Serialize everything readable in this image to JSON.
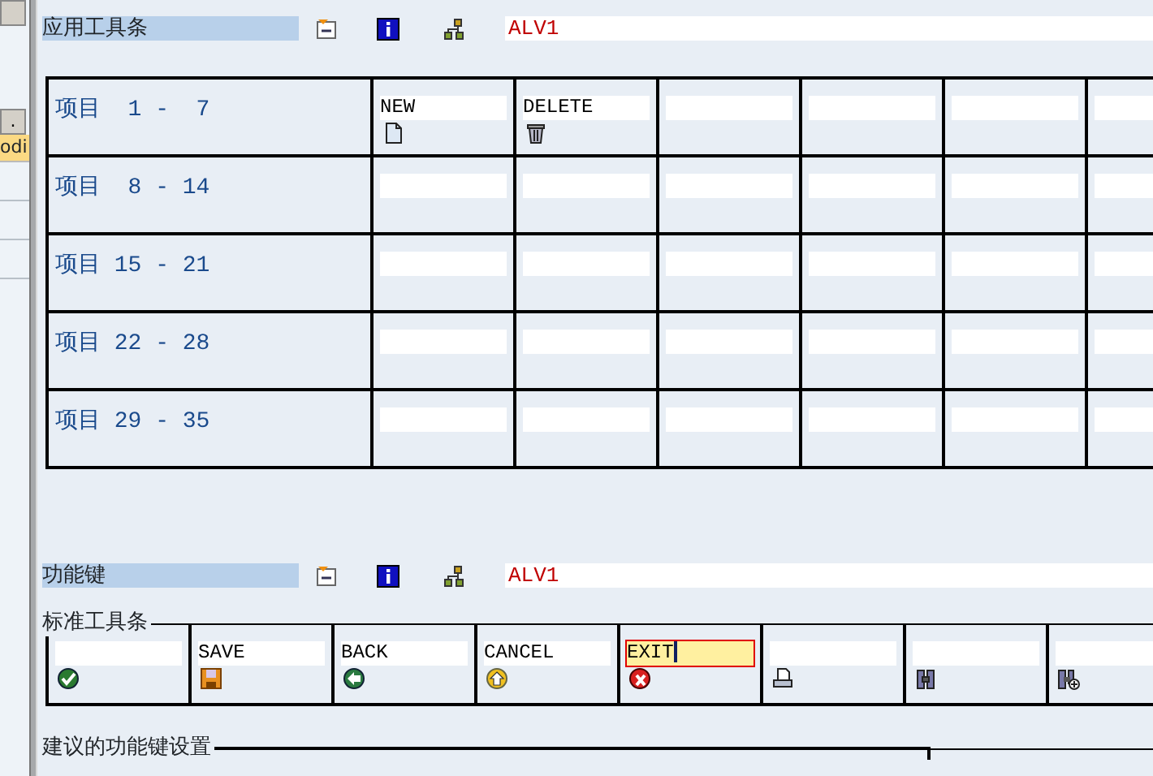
{
  "side_panel": {
    "button_label": ".",
    "highlighted_item": "odi"
  },
  "app_toolbar": {
    "title": "应用工具条",
    "status": "ALV1",
    "rows": [
      {
        "label": "项目  1 -  7",
        "items": [
          {
            "text": "NEW",
            "kind": "document"
          },
          {
            "text": "DELETE",
            "kind": "trash"
          }
        ]
      },
      {
        "label": "项目  8 - 14",
        "items": []
      },
      {
        "label": "项目 15 - 21",
        "items": []
      },
      {
        "label": "项目 22 - 28",
        "items": []
      },
      {
        "label": "项目 29 - 35",
        "items": []
      }
    ]
  },
  "function_keys": {
    "title": "功能键",
    "status": "ALV1"
  },
  "standard_toolbar": {
    "title": "标准工具条",
    "keys": [
      {
        "kind": "check",
        "selected": false
      },
      {
        "text": "SAVE",
        "kind": "save",
        "selected": false
      },
      {
        "text": "BACK",
        "kind": "back",
        "selected": false
      },
      {
        "text": "CANCEL",
        "kind": "cancel",
        "selected": false
      },
      {
        "text": "EXIT",
        "kind": "exit",
        "selected": true
      },
      {
        "kind": "print",
        "selected": false
      },
      {
        "kind": "find",
        "selected": false
      },
      {
        "kind": "find-next",
        "selected": false
      }
    ]
  },
  "recommended_keys": {
    "title": "建议的功能键设置"
  }
}
